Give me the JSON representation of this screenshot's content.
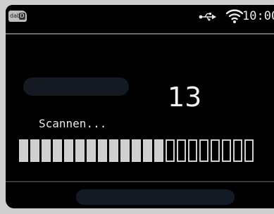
{
  "status_bar": {
    "badge_text": "dab",
    "badge_suffix": "D",
    "usb_icon": "usb-icon",
    "wifi_icon": "wifi-icon",
    "time": "10:00"
  },
  "main": {
    "channel_count": "13",
    "status_label": "Scannen..."
  },
  "progress": {
    "total_segments": 21,
    "filled_segments": 13,
    "fraction": 0.619
  },
  "colors": {
    "background": "#000000",
    "foreground": "#f2f2f2",
    "segment_filled": "#cfcfcf"
  }
}
